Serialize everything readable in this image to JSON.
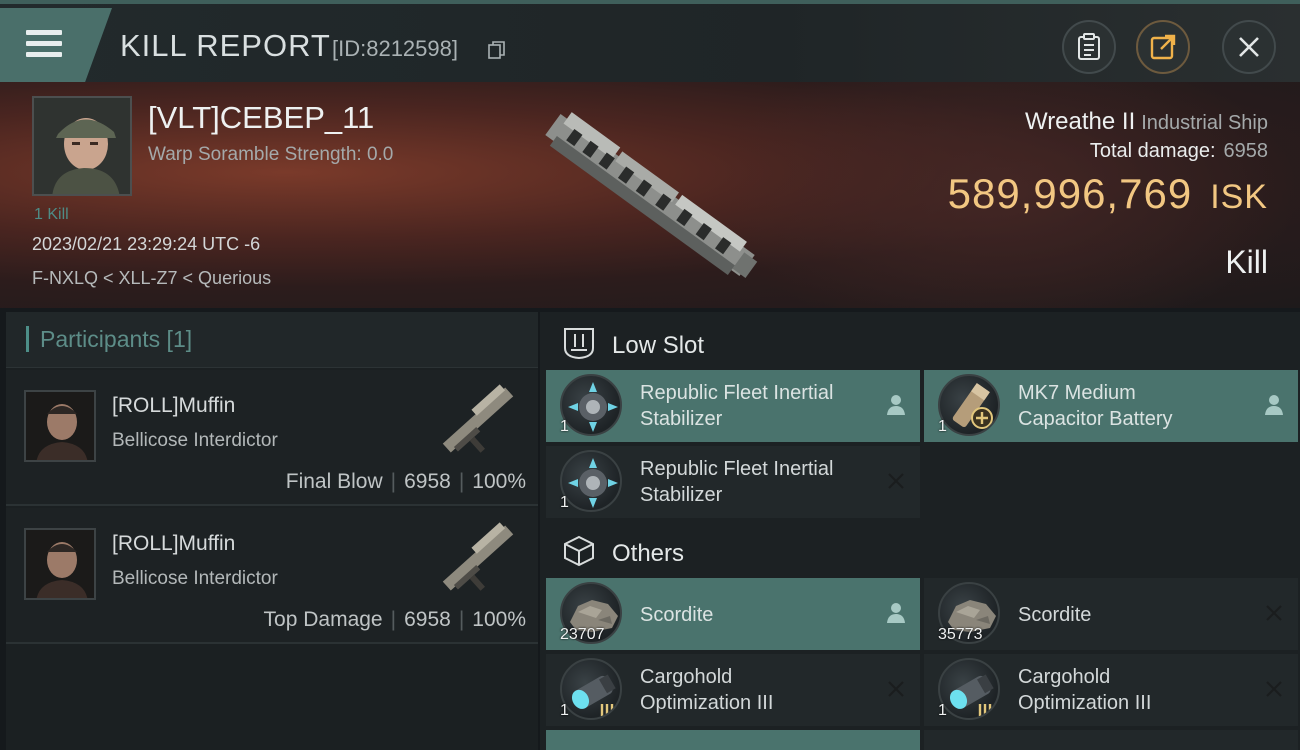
{
  "header": {
    "title": "KILL REPORT",
    "id_label": "[ID:8212598]"
  },
  "victim": {
    "name": "[VLT]CEBEP_11",
    "warp_scramble": "Warp Soramble Strength: 0.0",
    "kill_count": "1 Kill",
    "timestamp": "2023/02/21 23:29:24 UTC -6",
    "location": "F-NXLQ < XLL-Z7 < Querious",
    "ship_name": "Wreathe II",
    "ship_class": "Industrial Ship",
    "total_damage_label": "Total damage:",
    "total_damage": "6958",
    "isk_value": "589,996,769",
    "isk_unit": "ISK",
    "result": "Kill"
  },
  "participants": {
    "header": "Participants [1]",
    "rows": [
      {
        "name": "[ROLL]Muffin",
        "ship": "Bellicose Interdictor",
        "stat_label": "Final Blow",
        "damage": "6958",
        "percent": "100%"
      },
      {
        "name": "[ROLL]Muffin",
        "ship": "Bellicose Interdictor",
        "stat_label": "Top Damage",
        "damage": "6958",
        "percent": "100%"
      }
    ]
  },
  "sections": {
    "low_slot": "Low Slot",
    "others": "Others"
  },
  "modules": [
    {
      "line1": "Republic Fleet Inertial",
      "line2": "Stabilizer",
      "qty": "1",
      "tag": "person-icon"
    },
    {
      "line1": "MK7 Medium",
      "line2": "Capacitor Battery",
      "qty": "1",
      "tag": "person-icon"
    },
    {
      "line1": "Republic Fleet Inertial",
      "line2": "Stabilizer",
      "qty": "1",
      "tag": "close-icon"
    },
    {
      "line1": "Scordite",
      "qty": "23707",
      "tag": "person-icon"
    },
    {
      "line1": "Scordite",
      "qty": "35773",
      "tag": "close-icon"
    },
    {
      "line1": "Cargohold",
      "line2": "Optimization III",
      "qty": "1",
      "tag": "close-icon"
    },
    {
      "line1": "Cargohold",
      "line2": "Optimization III",
      "qty": "1",
      "tag": "close-icon"
    }
  ],
  "colors": {
    "accent": "#4a736d",
    "isk": "#f2c782",
    "banner": "#4a2520"
  }
}
